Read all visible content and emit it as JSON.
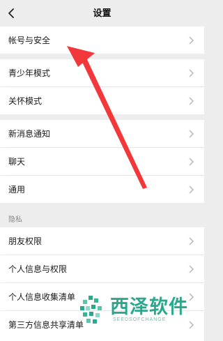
{
  "header": {
    "title": "设置",
    "back_icon": "chevron-left-icon"
  },
  "groups": [
    {
      "items": [
        {
          "label": "帐号与安全"
        }
      ]
    },
    {
      "items": [
        {
          "label": "青少年模式"
        },
        {
          "label": "关怀模式"
        }
      ]
    },
    {
      "items": [
        {
          "label": "新消息通知"
        },
        {
          "label": "聊天"
        },
        {
          "label": "通用"
        }
      ]
    }
  ],
  "privacy_section": {
    "title": "隐私",
    "items": [
      {
        "label": "朋友权限"
      },
      {
        "label": "个人信息与权限"
      },
      {
        "label": "个人信息收集清单"
      },
      {
        "label": "第三方信息共享清单"
      }
    ]
  },
  "colors": {
    "arrow": "#f2383a",
    "watermark": "#2aa88d",
    "background": "#ededed",
    "row": "#ffffff"
  },
  "watermark": {
    "name": "西泽软件",
    "subtitle": "SEEDSOFCHANGE"
  }
}
